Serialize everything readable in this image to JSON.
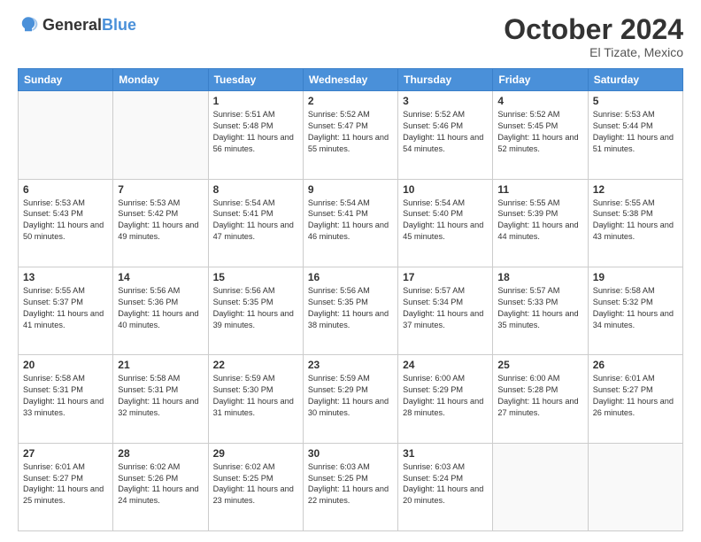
{
  "header": {
    "logo_general": "General",
    "logo_blue": "Blue",
    "month_title": "October 2024",
    "location": "El Tizate, Mexico"
  },
  "days_of_week": [
    "Sunday",
    "Monday",
    "Tuesday",
    "Wednesday",
    "Thursday",
    "Friday",
    "Saturday"
  ],
  "weeks": [
    [
      {
        "day": "",
        "empty": true
      },
      {
        "day": "",
        "empty": true
      },
      {
        "day": "1",
        "sunrise": "5:51 AM",
        "sunset": "5:48 PM",
        "daylight": "11 hours and 56 minutes."
      },
      {
        "day": "2",
        "sunrise": "5:52 AM",
        "sunset": "5:47 PM",
        "daylight": "11 hours and 55 minutes."
      },
      {
        "day": "3",
        "sunrise": "5:52 AM",
        "sunset": "5:46 PM",
        "daylight": "11 hours and 54 minutes."
      },
      {
        "day": "4",
        "sunrise": "5:52 AM",
        "sunset": "5:45 PM",
        "daylight": "11 hours and 52 minutes."
      },
      {
        "day": "5",
        "sunrise": "5:53 AM",
        "sunset": "5:44 PM",
        "daylight": "11 hours and 51 minutes."
      }
    ],
    [
      {
        "day": "6",
        "sunrise": "5:53 AM",
        "sunset": "5:43 PM",
        "daylight": "11 hours and 50 minutes."
      },
      {
        "day": "7",
        "sunrise": "5:53 AM",
        "sunset": "5:42 PM",
        "daylight": "11 hours and 49 minutes."
      },
      {
        "day": "8",
        "sunrise": "5:54 AM",
        "sunset": "5:41 PM",
        "daylight": "11 hours and 47 minutes."
      },
      {
        "day": "9",
        "sunrise": "5:54 AM",
        "sunset": "5:41 PM",
        "daylight": "11 hours and 46 minutes."
      },
      {
        "day": "10",
        "sunrise": "5:54 AM",
        "sunset": "5:40 PM",
        "daylight": "11 hours and 45 minutes."
      },
      {
        "day": "11",
        "sunrise": "5:55 AM",
        "sunset": "5:39 PM",
        "daylight": "11 hours and 44 minutes."
      },
      {
        "day": "12",
        "sunrise": "5:55 AM",
        "sunset": "5:38 PM",
        "daylight": "11 hours and 43 minutes."
      }
    ],
    [
      {
        "day": "13",
        "sunrise": "5:55 AM",
        "sunset": "5:37 PM",
        "daylight": "11 hours and 41 minutes."
      },
      {
        "day": "14",
        "sunrise": "5:56 AM",
        "sunset": "5:36 PM",
        "daylight": "11 hours and 40 minutes."
      },
      {
        "day": "15",
        "sunrise": "5:56 AM",
        "sunset": "5:35 PM",
        "daylight": "11 hours and 39 minutes."
      },
      {
        "day": "16",
        "sunrise": "5:56 AM",
        "sunset": "5:35 PM",
        "daylight": "11 hours and 38 minutes."
      },
      {
        "day": "17",
        "sunrise": "5:57 AM",
        "sunset": "5:34 PM",
        "daylight": "11 hours and 37 minutes."
      },
      {
        "day": "18",
        "sunrise": "5:57 AM",
        "sunset": "5:33 PM",
        "daylight": "11 hours and 35 minutes."
      },
      {
        "day": "19",
        "sunrise": "5:58 AM",
        "sunset": "5:32 PM",
        "daylight": "11 hours and 34 minutes."
      }
    ],
    [
      {
        "day": "20",
        "sunrise": "5:58 AM",
        "sunset": "5:31 PM",
        "daylight": "11 hours and 33 minutes."
      },
      {
        "day": "21",
        "sunrise": "5:58 AM",
        "sunset": "5:31 PM",
        "daylight": "11 hours and 32 minutes."
      },
      {
        "day": "22",
        "sunrise": "5:59 AM",
        "sunset": "5:30 PM",
        "daylight": "11 hours and 31 minutes."
      },
      {
        "day": "23",
        "sunrise": "5:59 AM",
        "sunset": "5:29 PM",
        "daylight": "11 hours and 30 minutes."
      },
      {
        "day": "24",
        "sunrise": "6:00 AM",
        "sunset": "5:29 PM",
        "daylight": "11 hours and 28 minutes."
      },
      {
        "day": "25",
        "sunrise": "6:00 AM",
        "sunset": "5:28 PM",
        "daylight": "11 hours and 27 minutes."
      },
      {
        "day": "26",
        "sunrise": "6:01 AM",
        "sunset": "5:27 PM",
        "daylight": "11 hours and 26 minutes."
      }
    ],
    [
      {
        "day": "27",
        "sunrise": "6:01 AM",
        "sunset": "5:27 PM",
        "daylight": "11 hours and 25 minutes."
      },
      {
        "day": "28",
        "sunrise": "6:02 AM",
        "sunset": "5:26 PM",
        "daylight": "11 hours and 24 minutes."
      },
      {
        "day": "29",
        "sunrise": "6:02 AM",
        "sunset": "5:25 PM",
        "daylight": "11 hours and 23 minutes."
      },
      {
        "day": "30",
        "sunrise": "6:03 AM",
        "sunset": "5:25 PM",
        "daylight": "11 hours and 22 minutes."
      },
      {
        "day": "31",
        "sunrise": "6:03 AM",
        "sunset": "5:24 PM",
        "daylight": "11 hours and 20 minutes."
      },
      {
        "day": "",
        "empty": true
      },
      {
        "day": "",
        "empty": true
      }
    ]
  ]
}
